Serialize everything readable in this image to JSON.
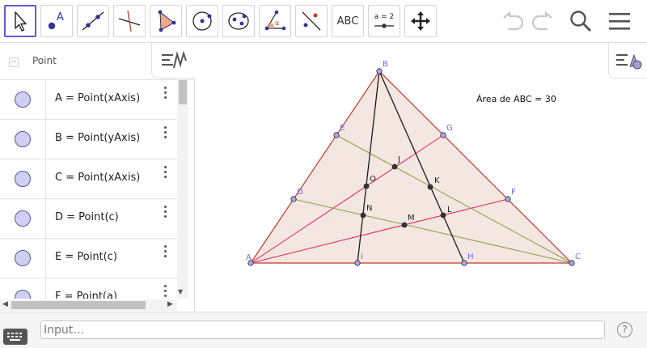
{
  "toolbar": {
    "tools": [
      {
        "name": "move-tool",
        "label": ""
      },
      {
        "name": "point-tool",
        "label": "A"
      },
      {
        "name": "line-tool",
        "label": ""
      },
      {
        "name": "perpendicular-line-tool",
        "label": ""
      },
      {
        "name": "polygon-tool",
        "label": ""
      },
      {
        "name": "circle-center-point-tool",
        "label": ""
      },
      {
        "name": "ellipse-tool",
        "label": ""
      },
      {
        "name": "angle-tool",
        "label": "α"
      },
      {
        "name": "reflect-tool",
        "label": ""
      },
      {
        "name": "text-tool",
        "label": "ABC"
      },
      {
        "name": "slider-tool",
        "label": "a = 2"
      },
      {
        "name": "move-graphics-view-tool",
        "label": ""
      }
    ]
  },
  "algebra": {
    "group_label": "Point",
    "collapse_symbol": "−",
    "rows": [
      {
        "definition": "A = Point(xAxis)"
      },
      {
        "definition": "B = Point(yAxis)"
      },
      {
        "definition": "C = Point(xAxis)"
      },
      {
        "definition": "D = Point(c)"
      },
      {
        "definition": "E = Point(c)"
      },
      {
        "definition": "F = Point(a)"
      }
    ],
    "marble_color": "#cfcff3"
  },
  "graphics": {
    "area_text": "Área de  ABC = 30",
    "triangle_fill": "#f4e6e1",
    "triangle_stroke": "#c0392b",
    "vertex_labels": {
      "A": "A",
      "B": "B",
      "C": "C"
    },
    "side_points": [
      "D",
      "E",
      "F",
      "G",
      "H",
      "I"
    ],
    "intersection_points": [
      "J",
      "K",
      "L",
      "M",
      "N",
      "O"
    ],
    "colors": {
      "red_line": "#e8204e",
      "olive_line": "#8aa13a",
      "black_line": "#1a1a1a",
      "free_point": "#6a6af0",
      "dependent_point": "#333333",
      "label_blue": "#6a6ae8"
    }
  },
  "input": {
    "placeholder": "Input…"
  },
  "help_symbol": "?"
}
